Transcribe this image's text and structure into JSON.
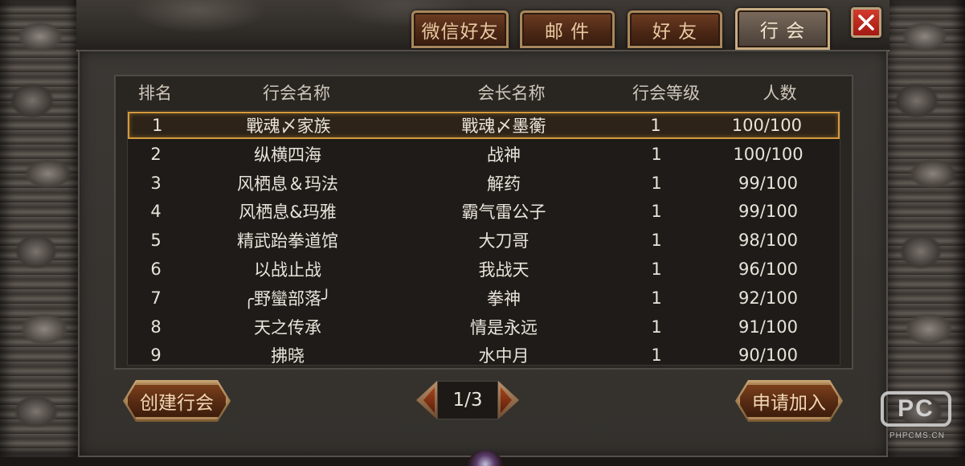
{
  "tabs": [
    {
      "label": "微信好友",
      "active": false
    },
    {
      "label": "邮 件",
      "active": false
    },
    {
      "label": "好 友",
      "active": false
    },
    {
      "label": "行 会",
      "active": true
    }
  ],
  "close_icon": "close-x-icon",
  "table": {
    "headers": [
      "排名",
      "行会名称",
      "会长名称",
      "行会等级",
      "人数"
    ],
    "selected_row": 0,
    "rows": [
      {
        "rank": "1",
        "name": "戰魂〆家族",
        "leader": "戰魂〆墨蘅",
        "level": "1",
        "members": "100/100"
      },
      {
        "rank": "2",
        "name": "纵横四海",
        "leader": "战神",
        "level": "1",
        "members": "100/100"
      },
      {
        "rank": "3",
        "name": "风栖息＆玛法",
        "leader": "解药",
        "level": "1",
        "members": "99/100"
      },
      {
        "rank": "4",
        "name": "风栖息&玛雅",
        "leader": "霸气雷公子",
        "level": "1",
        "members": "99/100"
      },
      {
        "rank": "5",
        "name": "精武跆拳道馆",
        "leader": "大刀哥",
        "level": "1",
        "members": "98/100"
      },
      {
        "rank": "6",
        "name": "以战止战",
        "leader": "我战天",
        "level": "1",
        "members": "96/100"
      },
      {
        "rank": "7",
        "name": "╭野蠻部落╯",
        "leader": "拳神",
        "level": "1",
        "members": "92/100"
      },
      {
        "rank": "8",
        "name": "天之传承",
        "leader": "情是永远",
        "level": "1",
        "members": "91/100"
      },
      {
        "rank": "9",
        "name": "拂晓",
        "leader": "水中月",
        "level": "1",
        "members": "90/100"
      }
    ]
  },
  "buttons": {
    "create": "创建行会",
    "apply": "申请加入"
  },
  "pager": {
    "text": "1/3"
  },
  "watermark": {
    "logo": "PC",
    "text": "PHPCMS.CN"
  },
  "colors": {
    "selected_border": "#d49a3c",
    "tab_text": "#e8c9a0",
    "close_red": "#c22a1e"
  }
}
